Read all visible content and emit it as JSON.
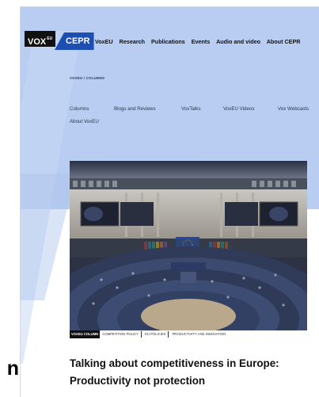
{
  "brand": {
    "vox": "VOX",
    "vox_sup": "EU",
    "cepr": "CEPR"
  },
  "nav": [
    "VoxEU",
    "Research",
    "Publications",
    "Events",
    "Audio and video",
    "About CEPR"
  ],
  "breadcrumb": "VOXEU / COLUMNS",
  "subnav": [
    "Columns",
    "Blogs and Reviews",
    "VoxTalks",
    "VoxEU Videos",
    "Vox Webcasts",
    "About VoxEU"
  ],
  "tags": {
    "type": "VOXEU COLUMN",
    "topics": [
      "COMPETITION POLICY",
      "EU POLICIES",
      "PRODUCTIVITY AND INNOVATION"
    ]
  },
  "article": {
    "title": "Talking about competitiveness in Europe: Productivity not protection"
  },
  "left_edge_fragment": "n",
  "colors": {
    "band": "#b8cdf1",
    "cepr_blue": "#1d4fb3",
    "eu_blue": "#1f4aa8"
  }
}
